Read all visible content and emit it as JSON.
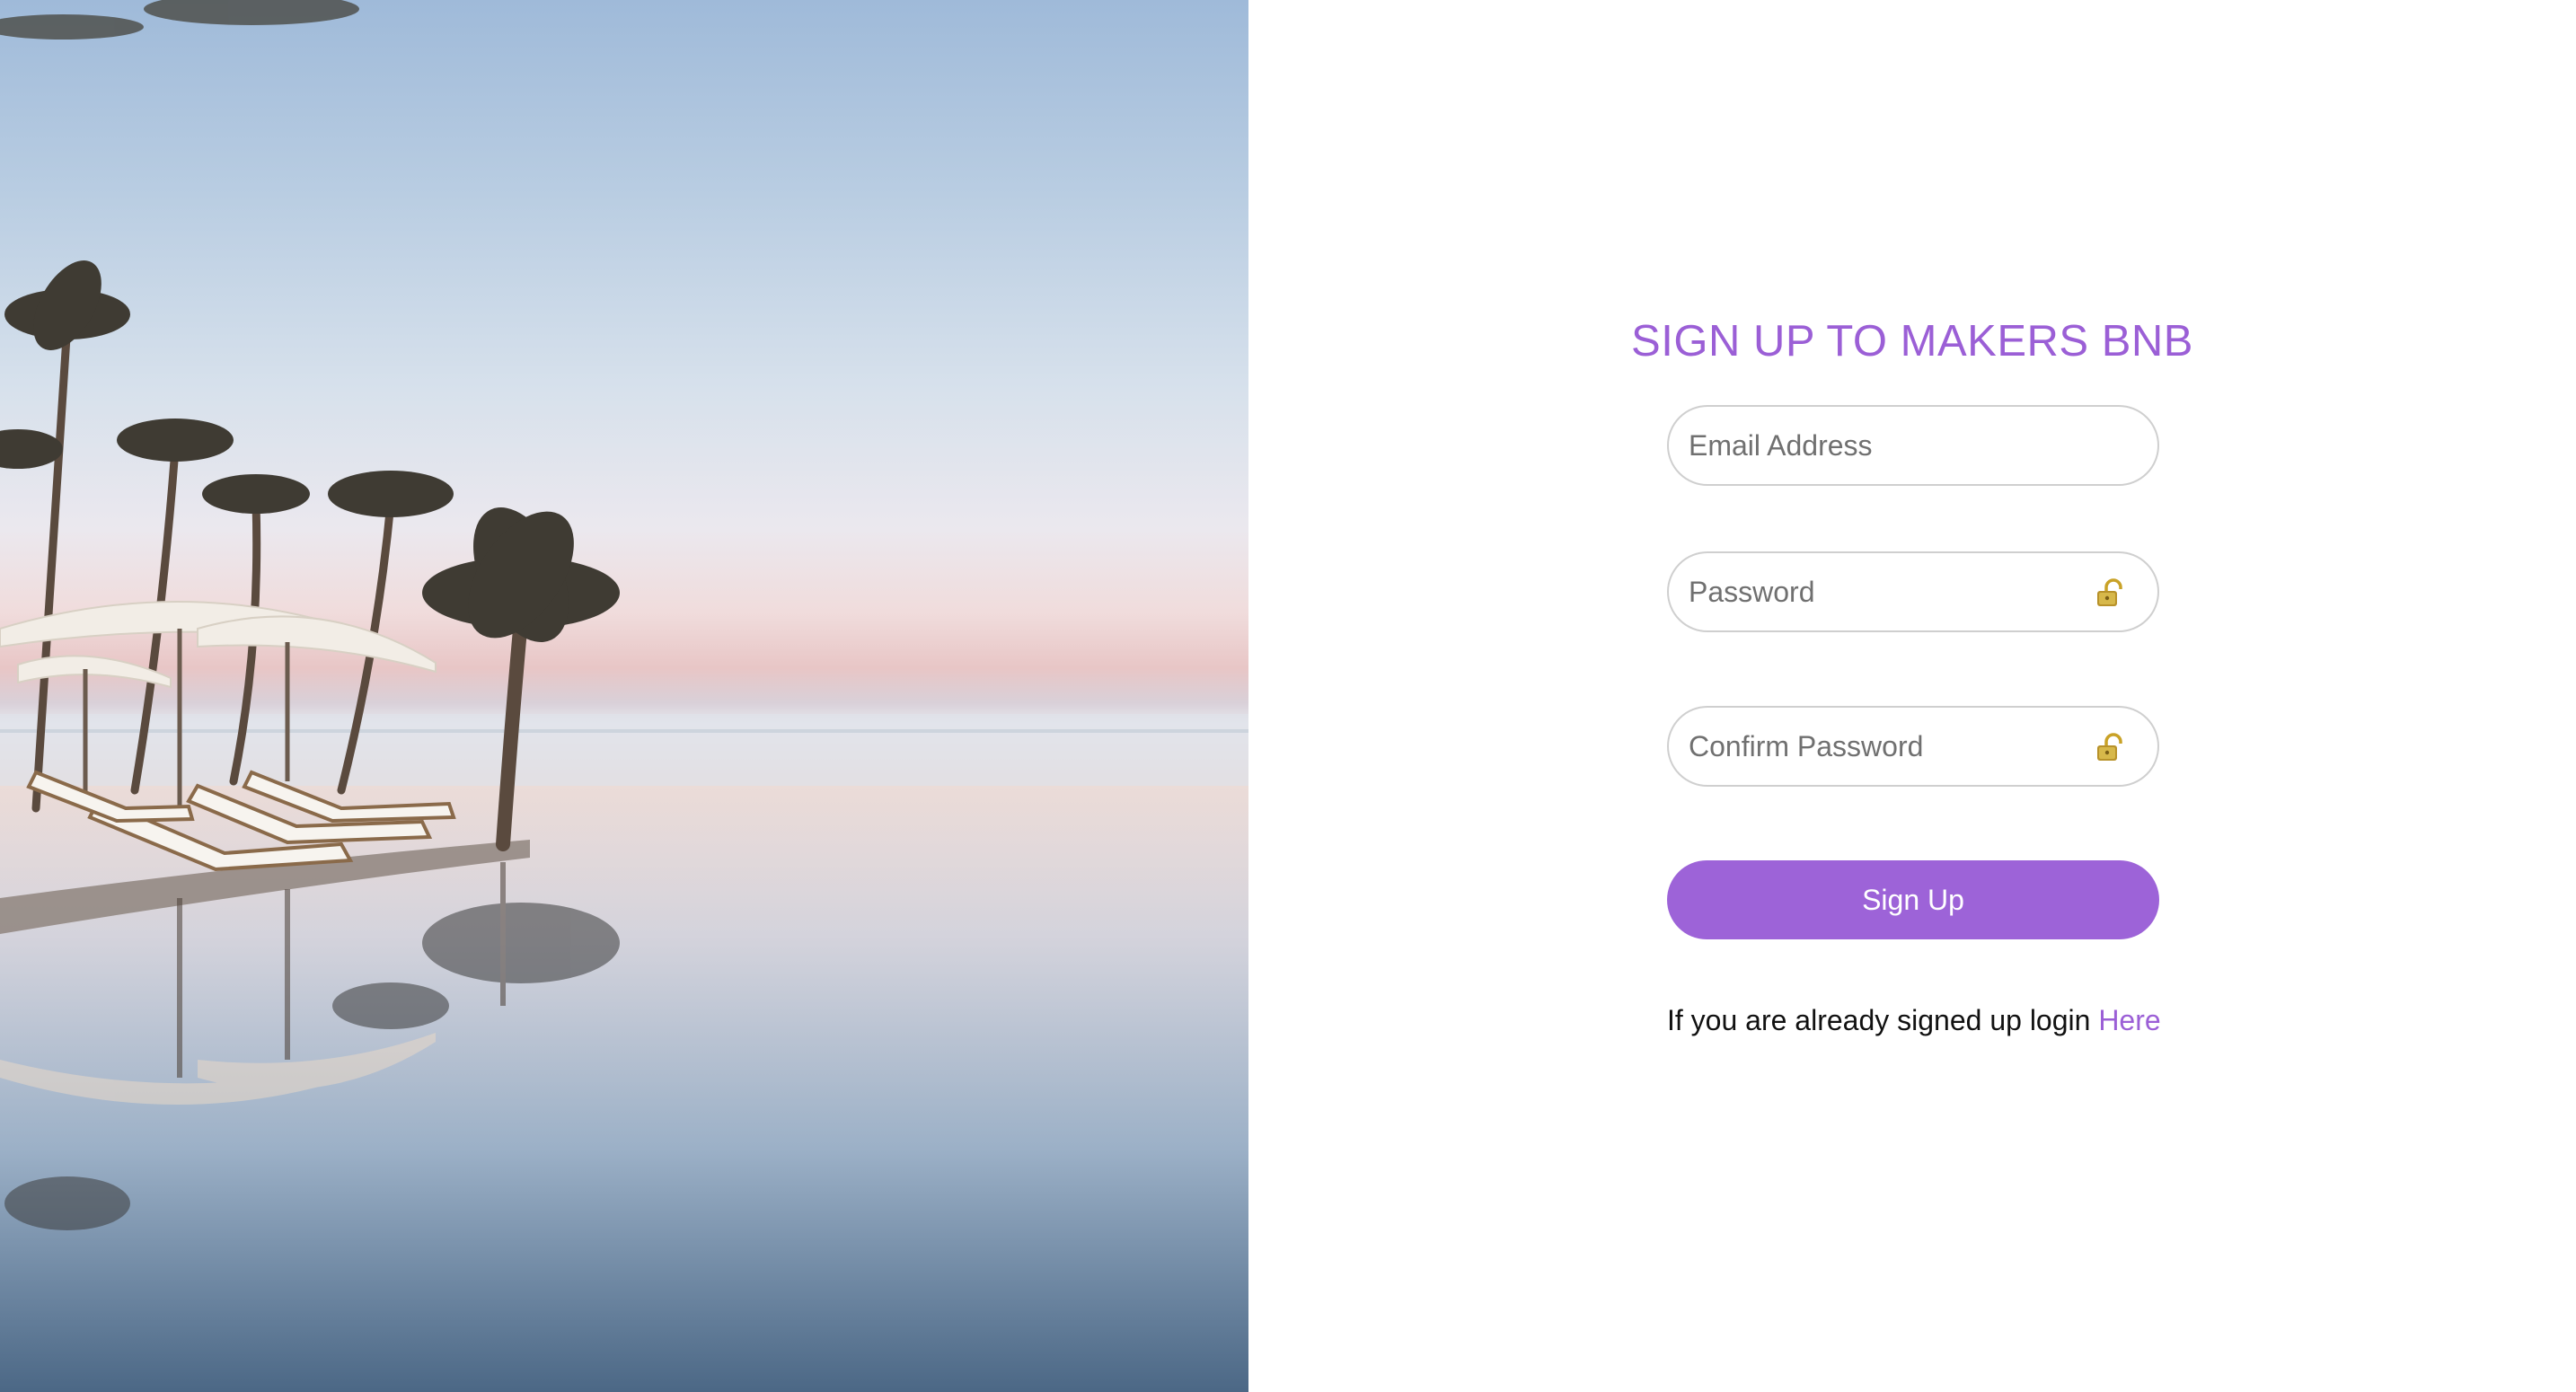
{
  "hero": {
    "image": "beach-resort-infinity-pool-photo",
    "scene": [
      "palm-trees",
      "white-umbrellas",
      "sun-loungers",
      "infinity-pool",
      "ocean",
      "sunset-sky"
    ]
  },
  "form": {
    "title": "SIGN UP TO MAKERS BNB",
    "email_placeholder": "Email Address",
    "password_placeholder": "Password",
    "confirm_password_placeholder": "Confirm Password",
    "password_icon": "lock-icon",
    "submit_label": "Sign Up",
    "login_prompt": "If you are already signed up login",
    "login_link": "Here"
  },
  "colors": {
    "accent": "#9b5fd6",
    "button": "#9d63d8",
    "input_border": "#cfcfcf"
  }
}
